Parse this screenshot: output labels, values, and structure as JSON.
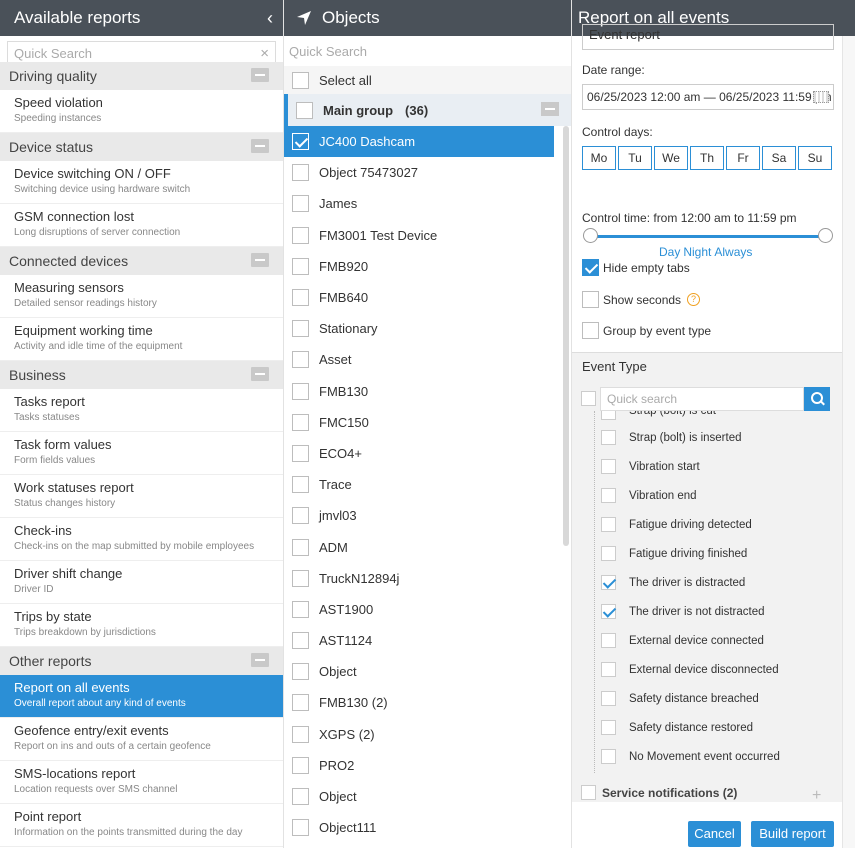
{
  "reports_panel": {
    "title": "Available reports",
    "search_placeholder": "Quick Search",
    "groups": [
      {
        "name": "Driving quality",
        "items": [
          {
            "title": "Speed violation",
            "sub": "Speeding instances"
          }
        ]
      },
      {
        "name": "Device status",
        "items": [
          {
            "title": "Device switching ON / OFF",
            "sub": "Switching device using hardware switch"
          },
          {
            "title": "GSM connection lost",
            "sub": "Long disruptions of server connection"
          }
        ]
      },
      {
        "name": "Connected devices",
        "items": [
          {
            "title": "Measuring sensors",
            "sub": "Detailed sensor readings history"
          },
          {
            "title": "Equipment working time",
            "sub": "Activity and idle time of the equipment"
          }
        ]
      },
      {
        "name": "Business",
        "items": [
          {
            "title": "Tasks report",
            "sub": "Tasks statuses"
          },
          {
            "title": "Task form values",
            "sub": "Form fields values"
          },
          {
            "title": "Work statuses report",
            "sub": "Status changes history"
          },
          {
            "title": "Check-ins",
            "sub": "Check-ins on the map submitted by mobile employees"
          },
          {
            "title": "Driver shift change",
            "sub": "Driver ID"
          },
          {
            "title": "Trips by state",
            "sub": "Trips breakdown by jurisdictions"
          }
        ]
      },
      {
        "name": "Other reports",
        "items": [
          {
            "title": "Report on all events",
            "sub": "Overall report about any kind of events",
            "active": true
          },
          {
            "title": "Geofence entry/exit events",
            "sub": "Report on ins and outs of a certain geofence"
          },
          {
            "title": "SMS-locations report",
            "sub": "Location requests over SMS channel"
          },
          {
            "title": "Point report",
            "sub": "Information on the points transmitted during the day"
          }
        ]
      }
    ]
  },
  "objects_panel": {
    "title": "Objects",
    "search_placeholder": "Quick Search",
    "select_all": "Select all",
    "group_name": "Main group",
    "group_count": "(36)",
    "objects": [
      {
        "name": "JC400 Dashcam",
        "checked": true
      },
      {
        "name": "Object 75473027"
      },
      {
        "name": "James"
      },
      {
        "name": "FM3001 Test Device"
      },
      {
        "name": "FMB920"
      },
      {
        "name": "FMB640"
      },
      {
        "name": "Stationary"
      },
      {
        "name": "Asset"
      },
      {
        "name": "FMB130"
      },
      {
        "name": "FMC150"
      },
      {
        "name": "ECO4+"
      },
      {
        "name": "Trace"
      },
      {
        "name": "jmvl03"
      },
      {
        "name": "ADM"
      },
      {
        "name": "TruckN12894j"
      },
      {
        "name": "AST1900"
      },
      {
        "name": "AST1124"
      },
      {
        "name": "Object"
      },
      {
        "name": "FMB130 (2)"
      },
      {
        "name": "XGPS (2)"
      },
      {
        "name": "PRO2"
      },
      {
        "name": "Object"
      },
      {
        "name": "Object111"
      }
    ]
  },
  "settings_panel": {
    "title": "Report on all events",
    "report_name_value": "Event report",
    "date_range_label": "Date range:",
    "date_range_value": "06/25/2023 12:00 am — 06/25/2023 11:59 pm",
    "control_days_label": "Control days:",
    "days": [
      "Mo",
      "Tu",
      "We",
      "Th",
      "Fr",
      "Sa",
      "Su"
    ],
    "control_time_label": "Control time: from 12:00 am to 11:59 pm",
    "time_links": [
      "Day",
      "Night",
      "Always"
    ],
    "hide_empty_tabs": "Hide empty tabs",
    "show_seconds": "Show seconds",
    "group_by_event_type": "Group by event type",
    "help_glyph": "?",
    "event_type_title": "Event Type",
    "event_search_placeholder": "Quick search",
    "events": [
      {
        "name": "Strap (bolt) is cut",
        "partial": true
      },
      {
        "name": "Strap (bolt) is inserted"
      },
      {
        "name": "Vibration start"
      },
      {
        "name": "Vibration end"
      },
      {
        "name": "Fatigue driving detected"
      },
      {
        "name": "Fatigue driving finished"
      },
      {
        "name": "The driver is distracted",
        "checked": true
      },
      {
        "name": "The driver is not distracted",
        "checked": true
      },
      {
        "name": "External device connected"
      },
      {
        "name": "External device disconnected"
      },
      {
        "name": "Safety distance breached"
      },
      {
        "name": "Safety distance restored"
      },
      {
        "name": "No Movement event occurred"
      }
    ],
    "service_notifications": "Service notifications (2)",
    "cancel_label": "Cancel",
    "build_label": "Build report"
  }
}
